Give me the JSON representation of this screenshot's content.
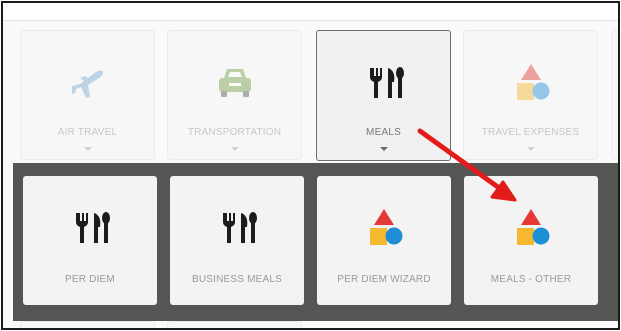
{
  "categories": [
    {
      "label": "AIR TRAVEL",
      "icon": "airplane-icon"
    },
    {
      "label": "TRANSPORTATION",
      "icon": "car-icon"
    },
    {
      "label": "MEALS",
      "icon": "fork-knife-icon"
    },
    {
      "label": "TRAVEL EXPENSES",
      "icon": "shapes-icon"
    }
  ],
  "subcategories": [
    {
      "label": "PER DIEM",
      "icon": "fork-knife-icon"
    },
    {
      "label": "BUSINESS MEALS",
      "icon": "fork-knife-icon"
    },
    {
      "label": "PER DIEM WIZARD",
      "icon": "shapes-icon"
    },
    {
      "label": "MEALS - OTHER",
      "icon": "shapes-icon"
    }
  ],
  "colors": {
    "panel": "#545654",
    "airplane": "#7aa9cf",
    "car": "#73a047",
    "triangle": "#e53935",
    "square": "#f5b82e",
    "circle": "#1e8fd6",
    "arrow": "#e31b1b"
  }
}
